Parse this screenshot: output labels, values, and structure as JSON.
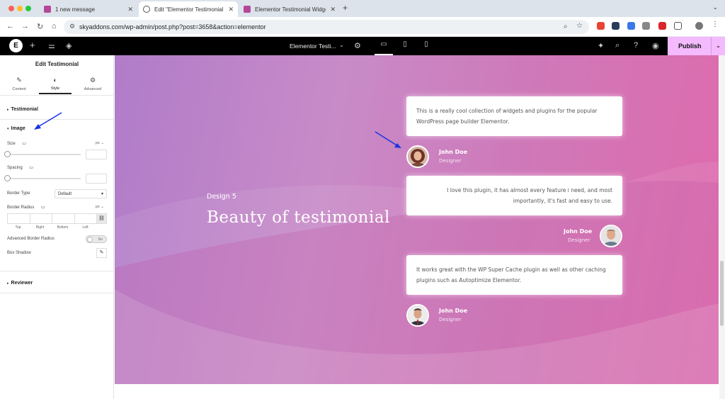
{
  "browser": {
    "tabs": [
      {
        "label": "1 new message",
        "favicon_color": "#b4479a"
      },
      {
        "label": "Edit \"Elementor Testimonial W",
        "favicon_color": "#555555"
      },
      {
        "label": "Elementor Testimonial Widget",
        "favicon_color": "#b4479a"
      }
    ],
    "new_tab": "+",
    "close": "✕",
    "url": "skyaddons.com/wp-admin/post.php?post=3658&action=elementor"
  },
  "editor_bar": {
    "logo": "E",
    "document_title": "Elementor Testi...",
    "publish_label": "Publish",
    "accent_color": "#f3bafd"
  },
  "panel": {
    "title": "Edit Testimonial",
    "tabs": [
      {
        "label": "Content",
        "icon": "pencil-icon"
      },
      {
        "label": "Style",
        "icon": "half-circle-icon"
      },
      {
        "label": "Advanced",
        "icon": "gear-icon"
      }
    ],
    "sections": {
      "testimonial": "Testimonial",
      "image": "Image",
      "reviewer": "Reviewer"
    },
    "controls": {
      "size_label": "Size",
      "size_unit": "px",
      "spacing_label": "Spacing",
      "border_type_label": "Border Type",
      "border_type_value": "Default",
      "border_radius_label": "Border Radius",
      "border_radius_unit": "px",
      "dims": [
        "Top",
        "Right",
        "Bottom",
        "Left"
      ],
      "advanced_border_radius_label": "Advanced Border Radius",
      "advanced_border_radius_toggle": "No",
      "box_shadow_label": "Box Shadow"
    }
  },
  "canvas": {
    "design_label": "Design 5",
    "title": "Beauty of testimonial",
    "testimonials": [
      {
        "text": "This is a really cool collection of widgets and plugins for the popular WordPress page builder Elementor.",
        "name": "John Doe",
        "role": "Designer",
        "align": "left"
      },
      {
        "text": "I love this plugin, it has almost every feature i need, and most importantly, it's fast and easy to use.",
        "name": "John Doe",
        "role": "Designer",
        "align": "right"
      },
      {
        "text": "It works great with the WP Super Cache plugin as well as other caching plugins such as Autoptimize Elementor.",
        "name": "John Doe",
        "role": "Designer",
        "align": "left"
      }
    ],
    "gradient_colors": [
      "#b07cc9",
      "#cf78b8",
      "#e06aac"
    ]
  },
  "annotation_color": "#1a35e0"
}
